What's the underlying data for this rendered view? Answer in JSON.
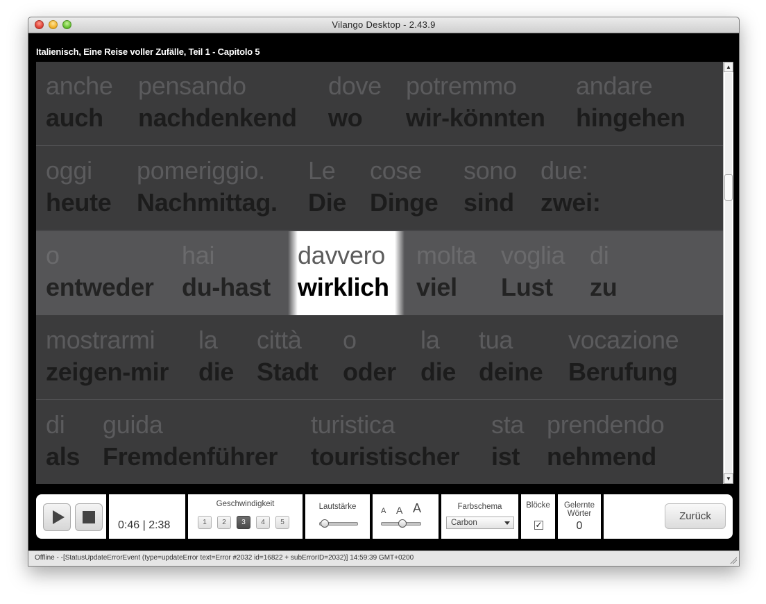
{
  "window": {
    "title": "Vilango Desktop - 2.43.9"
  },
  "lesson": {
    "title": "Italienisch, Eine Reise voller Zufälle, Teil 1 - Capitolo 5"
  },
  "lines": [
    {
      "words": [
        {
          "src": "anche",
          "tr": "auch"
        },
        {
          "src": "pensando",
          "tr": "nachdenkend"
        },
        {
          "src": "dove",
          "tr": "wo"
        },
        {
          "src": "potremmo",
          "tr": "wir-könnten"
        },
        {
          "src": "andare",
          "tr": "hingehen"
        }
      ]
    },
    {
      "words": [
        {
          "src": "oggi",
          "tr": "heute"
        },
        {
          "src": "pomeriggio.",
          "tr": "Nachmittag."
        },
        {
          "src": "Le",
          "tr": "Die"
        },
        {
          "src": "cose",
          "tr": "Dinge"
        },
        {
          "src": "sono",
          "tr": "sind"
        },
        {
          "src": "due:",
          "tr": "zwei:"
        }
      ]
    },
    {
      "words": [
        {
          "src": "o",
          "tr": "entweder"
        },
        {
          "src": "hai",
          "tr": "du-hast"
        },
        {
          "src": "davvero",
          "tr": "wirklich"
        },
        {
          "src": "molta",
          "tr": "viel"
        },
        {
          "src": "voglia",
          "tr": "Lust"
        },
        {
          "src": "di",
          "tr": "zu"
        }
      ]
    },
    {
      "words": [
        {
          "src": "mostrarmi",
          "tr": "zeigen-mir"
        },
        {
          "src": "la",
          "tr": "die"
        },
        {
          "src": "città",
          "tr": "Stadt"
        },
        {
          "src": "o",
          "tr": "oder"
        },
        {
          "src": "la",
          "tr": "die"
        },
        {
          "src": "tua",
          "tr": "deine"
        },
        {
          "src": "vocazione",
          "tr": "Berufung"
        }
      ]
    },
    {
      "words": [
        {
          "src": "di",
          "tr": "als"
        },
        {
          "src": "guida",
          "tr": "Fremdenführer"
        },
        {
          "src": "turistica",
          "tr": "touristischer"
        },
        {
          "src": "sta",
          "tr": "ist"
        },
        {
          "src": "prendendo",
          "tr": "nehmend"
        }
      ]
    }
  ],
  "current_line": 2,
  "current_word": 2,
  "scrollbar": {
    "up_glyph": "▲",
    "down_glyph": "▼"
  },
  "player": {
    "elapsed": "0:46",
    "separator": "|",
    "total": "2:38"
  },
  "speed": {
    "label": "Geschwindigkeit",
    "options": [
      "1",
      "2",
      "3",
      "4",
      "5"
    ],
    "selected": "3"
  },
  "volume": {
    "label": "Lautstärke",
    "level": 0.15
  },
  "font_size": {
    "small": "A",
    "medium": "A",
    "large": "A",
    "level": 0.55
  },
  "color_scheme": {
    "label": "Farbschema",
    "selected": "Carbon"
  },
  "blocks": {
    "label": "Blöcke",
    "checked": true,
    "check_glyph": "✓"
  },
  "learned_words": {
    "label_line1": "Gelernte",
    "label_line2": "Wörter",
    "count": "0"
  },
  "back_button": {
    "label": "Zurück"
  },
  "status": {
    "text": "Offline - -[StatusUpdateErrorEvent (type=updateError text=Error #2032 id=16822 + subErrorID=2032)] 14:59:39 GMT+0200"
  },
  "colors": {
    "highlight": "#ffffff",
    "reader_bg": "#3b3b3c",
    "current_line_bg": "#555557"
  }
}
